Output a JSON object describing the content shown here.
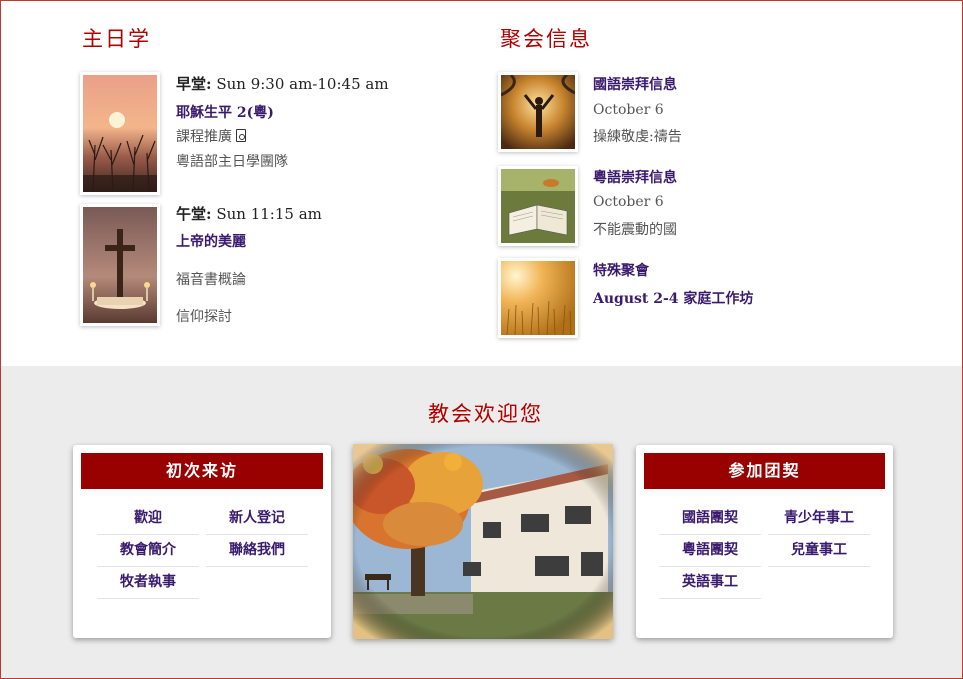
{
  "sunday_school": {
    "title": "主日学",
    "morning": {
      "time_label": "早堂:",
      "time_value": "Sun 9:30 am-10:45 am",
      "course": "耶穌生平 2(粵)",
      "recommend": "課程推廣",
      "team": "粵語部主日學團隊"
    },
    "afternoon": {
      "time_label": "午堂:",
      "time_value": "Sun 11:15 am",
      "course": "上帝的美麗",
      "item1": "福音書概論",
      "item2": "信仰探討"
    }
  },
  "gatherings": {
    "title": "聚会信息",
    "items": [
      {
        "title": "國語崇拜信息",
        "date": "October 6",
        "detail": "操練敬虔:禱告"
      },
      {
        "title": "粵語崇拜信息",
        "date": "October 6",
        "detail": "不能震動的國"
      },
      {
        "title": "特殊聚會",
        "date": "August 2-4 家庭工作坊",
        "detail": ""
      }
    ]
  },
  "welcome": {
    "title": "教会欢迎您",
    "first_visit": {
      "header": "初次来访",
      "links": [
        "歡迎",
        "新人登记",
        "教會簡介",
        "聯絡我們",
        "牧者執事"
      ]
    },
    "join": {
      "header": "参加团契",
      "links": [
        "國語團契",
        "青少年事工",
        "粵語團契",
        "兒童事工",
        "英語事工"
      ]
    }
  },
  "colors": {
    "accent_red": "#b00000",
    "header_red": "#990000",
    "link_purple": "#3a1a6e",
    "bottom_bg": "#ececec"
  }
}
